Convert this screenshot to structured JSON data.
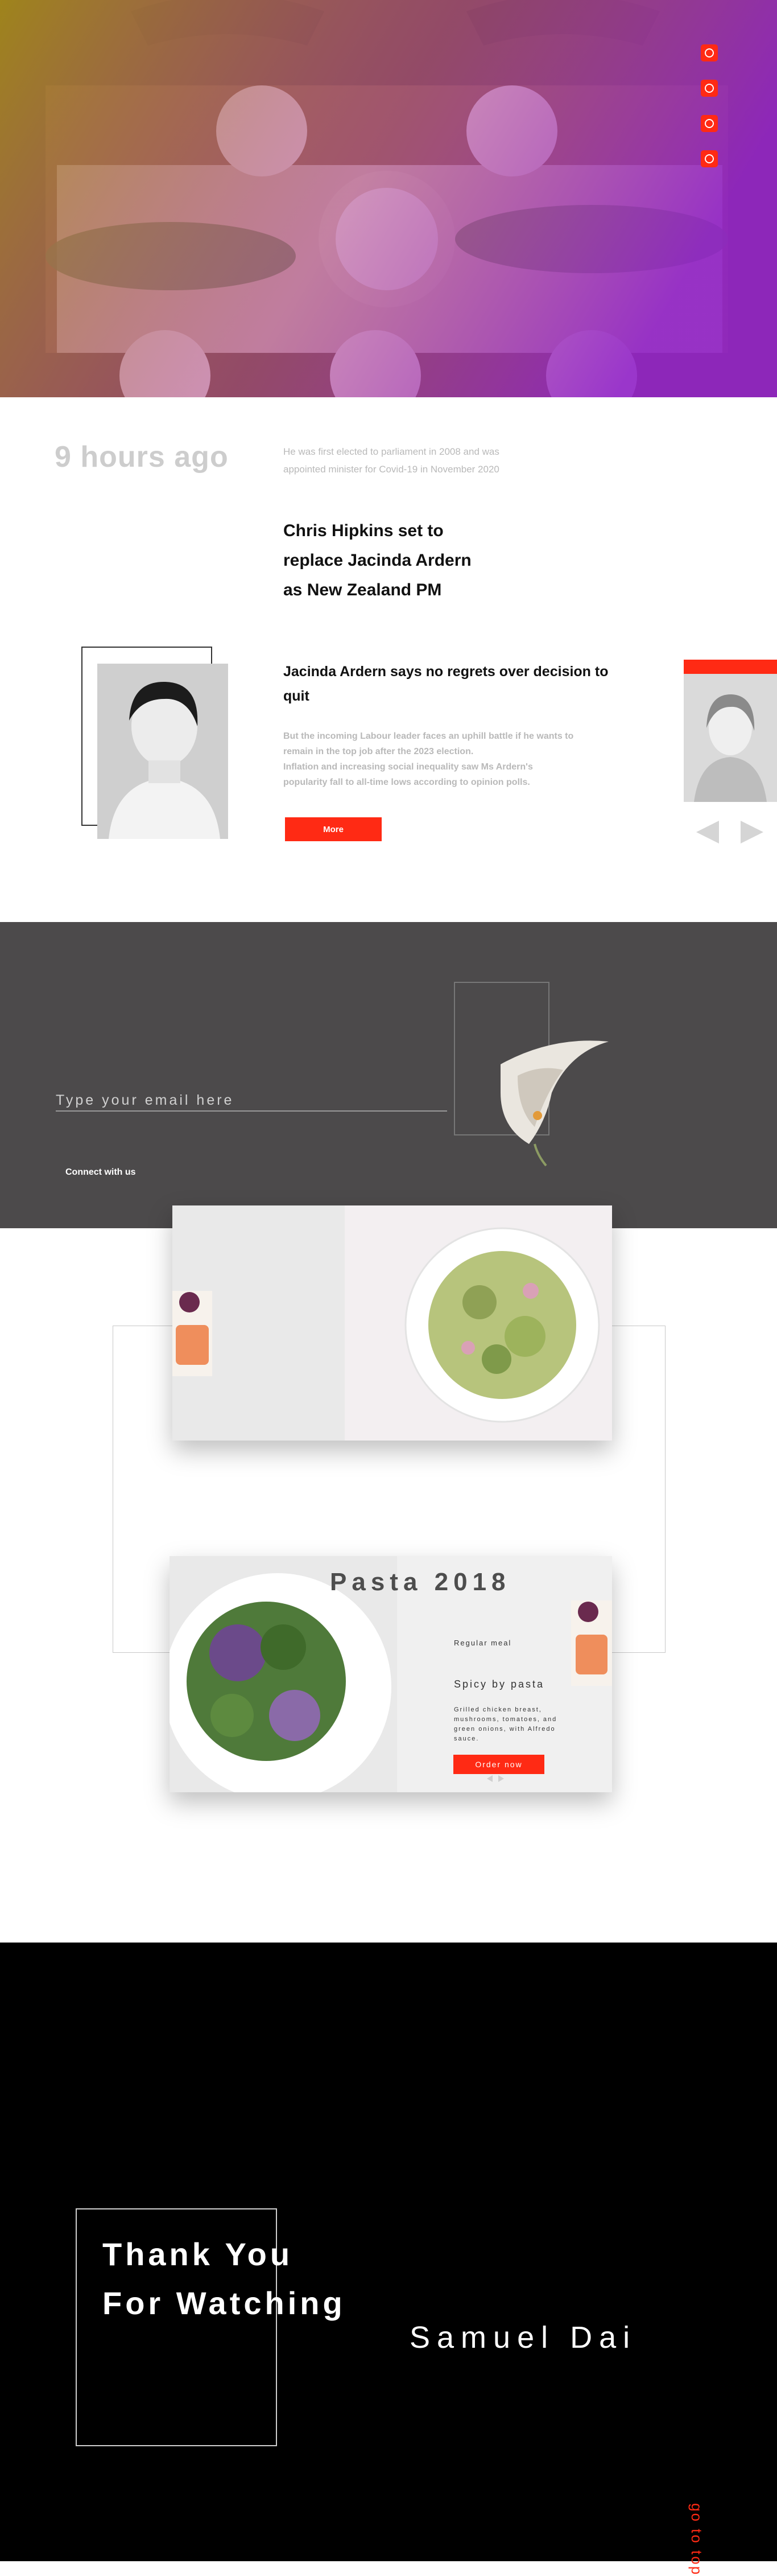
{
  "hero": {
    "social_icons": [
      "mail-icon",
      "pinterest-icon",
      "dribbble-icon",
      "linkedin-icon"
    ],
    "gradient": [
      "#a88e19",
      "#9123c9"
    ]
  },
  "news": {
    "time_ago": "9 hours ago",
    "intro": "He was first elected to parliament in 2008 and was appointed minister for Covid-19 in November 2020",
    "headline_lines": [
      "Chris Hipkins set to",
      "replace Jacinda Ardern",
      "as New Zealand PM"
    ],
    "sub_headline": "Jacinda Ardern says no regrets over decision to quit",
    "body_lines": [
      "But the incoming Labour leader faces an uphill battle if he wants to",
      "remain in the top job after the 2023 election.",
      "Inflation and increasing social inequality saw Ms Ardern's",
      "popularity fall to all-time lows according to opinion polls."
    ],
    "more_label": "More",
    "arrows": [
      "arrow-left-icon",
      "arrow-right-icon"
    ]
  },
  "newsletter": {
    "email_placeholder": "Type your email here",
    "connect_label": "Connect with us"
  },
  "food": {
    "title": "Pasta 2018",
    "regular_meal": "Regular meal",
    "spicy": "Spicy by pasta",
    "description": "Grilled chicken breast, mushrooms, tomatoes, and green onions, with Alfredo sauce.",
    "order_label": "Order now"
  },
  "footer": {
    "thanks_lines": [
      "Thank You",
      "For Watching"
    ],
    "author": "Samuel Dai",
    "go_top": "go to top"
  },
  "colors": {
    "accent": "#ff2a14",
    "dark_band": "#4c4a4b",
    "footer_bg": "#000000"
  }
}
